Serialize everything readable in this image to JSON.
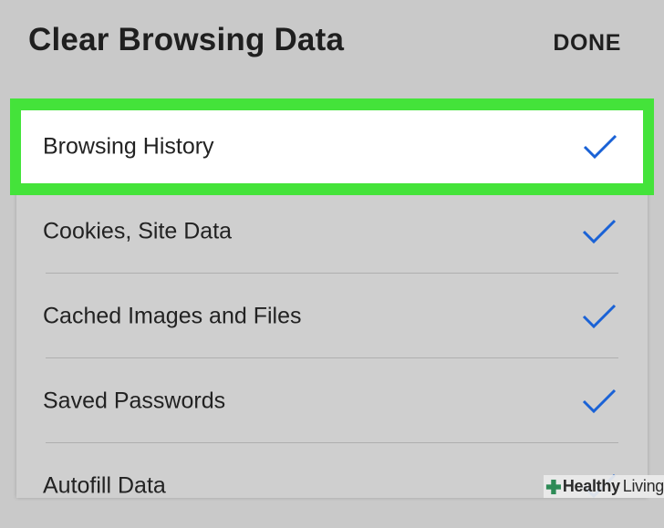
{
  "header": {
    "title": "Clear Browsing Data",
    "done_label": "DONE"
  },
  "items": [
    {
      "label": "Browsing History",
      "checked": true,
      "highlighted": true
    },
    {
      "label": "Cookies, Site Data",
      "checked": true
    },
    {
      "label": "Cached Images and Files",
      "checked": true
    },
    {
      "label": "Saved Passwords",
      "checked": true
    },
    {
      "label": "Autofill Data",
      "checked": true
    }
  ],
  "colors": {
    "background": "#c9c9c9",
    "highlight_border": "#44e33a",
    "checkmark": "#1a62d6",
    "text": "#222222"
  },
  "icons": {
    "checkmark": "checkmark-icon",
    "watermark": "medical-cross-icon"
  },
  "watermark": {
    "brand_bold": "Healthy",
    "brand_light": "Living"
  }
}
